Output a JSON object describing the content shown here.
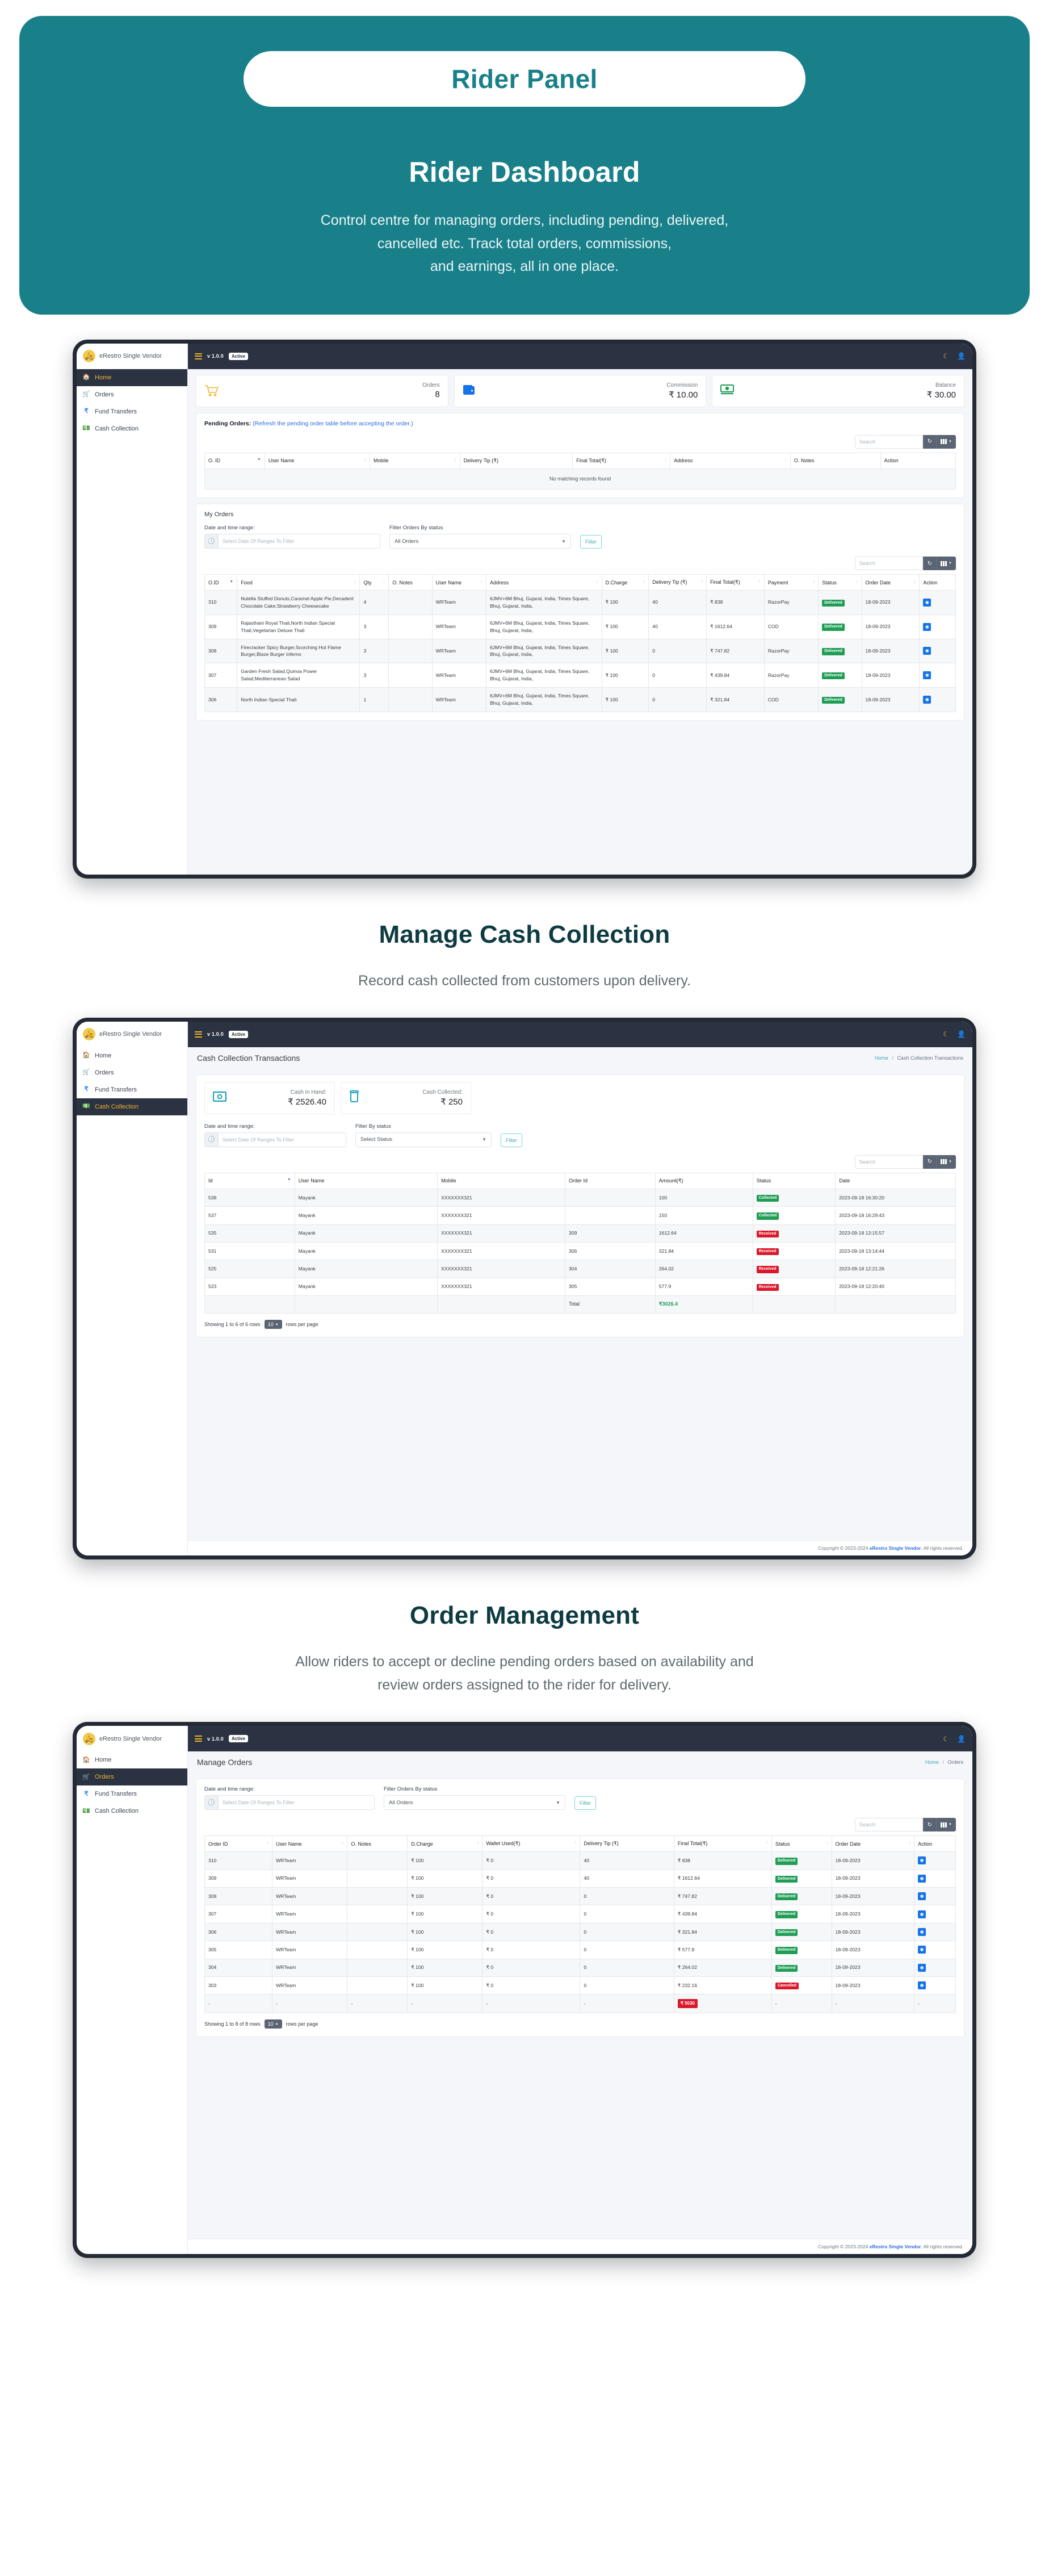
{
  "hero": {
    "pill_label": "Rider Panel",
    "title": "Rider Dashboard",
    "subtitle_line1": "Control centre for managing orders, including pending, delivered,",
    "subtitle_line2": "cancelled etc. Track total orders, commissions,",
    "subtitle_line3": "and earnings, all in one place.",
    "accent_color": "#19808a"
  },
  "sections": [
    {
      "title": "Manage Cash Collection",
      "subtitle_line1": "Record cash collected from customers upon delivery.",
      "subtitle_line2": ""
    },
    {
      "title": "Order Management",
      "subtitle_line1": "Allow riders to accept or decline pending orders based on availability and",
      "subtitle_line2": "review orders assigned to the rider for delivery."
    }
  ],
  "app": {
    "brand_name": "eRestro Single Vendor",
    "brand_logo_glyph": "🛵",
    "version": "v 1.0.0",
    "status_badge": "Active",
    "sidebar_items": [
      {
        "label": "Home",
        "icon": "home-icon"
      },
      {
        "label": "Orders",
        "icon": "cart-icon"
      },
      {
        "label": "Fund Transfers",
        "icon": "rupee-icon"
      },
      {
        "label": "Cash Collection",
        "icon": "cash-icon"
      }
    ],
    "topbar_icons": [
      "moon-icon",
      "user-icon"
    ],
    "footer": {
      "prefix": "Copyright © 2023-2024 ",
      "brand": "eRestro Single Vendor",
      "suffix": ". All rights reserved."
    }
  },
  "dashboard": {
    "active_nav": "Home",
    "stats": [
      {
        "label": "Orders",
        "value": "8",
        "icon": "cart-icon"
      },
      {
        "label": "Commission",
        "value": "₹ 10.00",
        "icon": "wallet-icon"
      },
      {
        "label": "Balance",
        "value": "₹ 30.00",
        "icon": "money-icon"
      }
    ],
    "pending": {
      "heading": "Pending Orders:",
      "note": "(Refresh the pending order table before accepting the order.)",
      "search_placeholder": "Search",
      "columns": [
        "O. ID",
        "User Name",
        "Mobile",
        "Delivery Tip (₹)",
        "Final Total(₹)",
        "Address",
        "O. Notes",
        "Action"
      ],
      "empty_message": "No matching records found"
    },
    "my_orders": {
      "title": "My Orders",
      "date_label": "Date and time range:",
      "date_placeholder": "Select Date Of Ranges To Filter",
      "status_label": "Filter Orders By status",
      "status_value": "All Orders",
      "filter_button": "Filter",
      "search_placeholder": "Search",
      "columns": [
        "O.ID",
        "Food",
        "Qty",
        "O. Notes",
        "User Name",
        "Address",
        "D.Charge",
        "Delivery Tip (₹)",
        "Final Total(₹)",
        "Payment",
        "Status",
        "Order Date",
        "Action"
      ],
      "rows": [
        {
          "oid": "310",
          "food": "Nutella Stuffed Donuts,Caramel Apple Pie,Decadent Chocolate Cake,Strawberry Cheesecake",
          "qty": "4",
          "notes": "",
          "user": "WRTeam",
          "address": "6JMV+6M Bhuj, Gujarat, India, Times Square, Bhuj, Gujarat, India,",
          "dcharge": "₹ 100",
          "tip": "40",
          "final": "₹ 838",
          "payment": "RazorPay",
          "status": "Delivered",
          "status_kind": "green",
          "date": "18-09-2023"
        },
        {
          "oid": "309",
          "food": "Rajasthani Royal Thali,North Indian Special Thali,Vegetarian Deluxe Thali",
          "qty": "3",
          "notes": "",
          "user": "WRTeam",
          "address": "6JMV+6M Bhuj, Gujarat, India, Times Square, Bhuj, Gujarat, India,",
          "dcharge": "₹ 100",
          "tip": "40",
          "final": "₹ 1612.64",
          "payment": "COD",
          "status": "Delivered",
          "status_kind": "green",
          "date": "18-09-2023"
        },
        {
          "oid": "308",
          "food": "Firecracker Spicy Burger,Scorching Hot Flame Burger,Blaze Burger Inferno",
          "qty": "3",
          "notes": "",
          "user": "WRTeam",
          "address": "6JMV+6M Bhuj, Gujarat, India, Times Square, Bhuj, Gujarat, India,",
          "dcharge": "₹ 100",
          "tip": "0",
          "final": "₹ 747.82",
          "payment": "RazorPay",
          "status": "Delivered",
          "status_kind": "green",
          "date": "18-09-2023"
        },
        {
          "oid": "307",
          "food": "Garden Fresh Salad,Quinoa Power Salad,Mediterranean Salad",
          "qty": "3",
          "notes": "",
          "user": "WRTeam",
          "address": "6JMV+6M Bhuj, Gujarat, India, Times Square, Bhuj, Gujarat, India,",
          "dcharge": "₹ 100",
          "tip": "0",
          "final": "₹ 439.84",
          "payment": "RazorPay",
          "status": "Delivered",
          "status_kind": "green",
          "date": "18-09-2023"
        },
        {
          "oid": "306",
          "food": "North Indian Special Thali",
          "qty": "1",
          "notes": "",
          "user": "WRTeam",
          "address": "6JMV+6M Bhuj, Gujarat, India, Times Square, Bhuj, Gujarat, India,",
          "dcharge": "₹ 100",
          "tip": "0",
          "final": "₹ 321.84",
          "payment": "COD",
          "status": "Delivered",
          "status_kind": "green",
          "date": "18-09-2023"
        }
      ]
    }
  },
  "cash_collection": {
    "active_nav": "Cash Collection",
    "page_title": "Cash Collection Transactions",
    "crumb_home": "Home",
    "crumb_current": "Cash Collection Transactions",
    "stats": [
      {
        "label": "Cash in Hand:",
        "value": "₹ 2526.40",
        "icon": "cash-note-icon"
      },
      {
        "label": "Cash Collected:",
        "value": "₹ 250",
        "icon": "cash-can-icon"
      }
    ],
    "date_label": "Date and time range:",
    "date_placeholder": "Select Date Of Ranges To Filter",
    "status_label": "Filter By status",
    "status_value": "Select Status",
    "filter_button": "Filter",
    "search_placeholder": "Search",
    "columns": [
      "Id",
      "User Name",
      "Mobile",
      "Order Id",
      "Amount(₹)",
      "Status",
      "Date"
    ],
    "rows": [
      {
        "id": "538",
        "user": "Mayank",
        "mobile": "XXXXXXX321",
        "order_id": "",
        "amount": "100",
        "status": "Collected",
        "status_kind": "green",
        "date": "2023-09-18 16:30:20"
      },
      {
        "id": "537",
        "user": "Mayank",
        "mobile": "XXXXXXX321",
        "order_id": "",
        "amount": "150",
        "status": "Collected",
        "status_kind": "green",
        "date": "2023-09-18 16:29:43"
      },
      {
        "id": "535",
        "user": "Mayank",
        "mobile": "XXXXXXX321",
        "order_id": "309",
        "amount": "1612.64",
        "status": "Received",
        "status_kind": "red",
        "date": "2023-09-18 13:15:57"
      },
      {
        "id": "531",
        "user": "Mayank",
        "mobile": "XXXXXXX321",
        "order_id": "306",
        "amount": "321.84",
        "status": "Received",
        "status_kind": "red",
        "date": "2023-09-18 13:14:44"
      },
      {
        "id": "525",
        "user": "Mayank",
        "mobile": "XXXXXXX321",
        "order_id": "304",
        "amount": "264.02",
        "status": "Received",
        "status_kind": "red",
        "date": "2023-09-18 12:21:26"
      },
      {
        "id": "523",
        "user": "Mayank",
        "mobile": "XXXXXXX321",
        "order_id": "305",
        "amount": "577.9",
        "status": "Received",
        "status_kind": "red",
        "date": "2023-09-18 12:20:40"
      }
    ],
    "total_label": "Total",
    "total_value": "₹3026.4",
    "showing_text": "Showing 1 to 6 of 6 rows",
    "rows_per_page": "10",
    "rows_per_page_suffix": "rows per page"
  },
  "manage_orders": {
    "active_nav": "Orders",
    "page_title": "Manage Orders",
    "crumb_home": "Home",
    "crumb_current": "Orders",
    "date_label": "Date and time range:",
    "date_placeholder": "Select Date Of Ranges To Filter",
    "status_label": "Filter Orders By status",
    "status_value": "All Orders",
    "filter_button": "Filter",
    "search_placeholder": "Search",
    "columns": [
      "Order ID",
      "User Name",
      "O. Notes",
      "D.Charge",
      "Wallet Used(₹)",
      "Delivery Tip (₹)",
      "Final Total(₹)",
      "Status",
      "Order Date",
      "Action"
    ],
    "rows": [
      {
        "order_id": "310",
        "user": "WRTeam",
        "notes": "",
        "dcharge": "₹ 100",
        "wallet": "₹ 0",
        "tip": "40",
        "final": "₹ 838",
        "status": "Delivered",
        "status_kind": "green",
        "date": "18-09-2023"
      },
      {
        "order_id": "309",
        "user": "WRTeam",
        "notes": "",
        "dcharge": "₹ 100",
        "wallet": "₹ 0",
        "tip": "40",
        "final": "₹ 1612.64",
        "status": "Delivered",
        "status_kind": "green",
        "date": "18-09-2023"
      },
      {
        "order_id": "308",
        "user": "WRTeam",
        "notes": "",
        "dcharge": "₹ 100",
        "wallet": "₹ 0",
        "tip": "0",
        "final": "₹ 747.82",
        "status": "Delivered",
        "status_kind": "green",
        "date": "18-09-2023"
      },
      {
        "order_id": "307",
        "user": "WRTeam",
        "notes": "",
        "dcharge": "₹ 100",
        "wallet": "₹ 0",
        "tip": "0",
        "final": "₹ 439.84",
        "status": "Delivered",
        "status_kind": "green",
        "date": "18-09-2023"
      },
      {
        "order_id": "306",
        "user": "WRTeam",
        "notes": "",
        "dcharge": "₹ 100",
        "wallet": "₹ 0",
        "tip": "0",
        "final": "₹ 321.84",
        "status": "Delivered",
        "status_kind": "green",
        "date": "18-09-2023"
      },
      {
        "order_id": "305",
        "user": "WRTeam",
        "notes": "",
        "dcharge": "₹ 100",
        "wallet": "₹ 0",
        "tip": "0",
        "final": "₹ 577.9",
        "status": "Delivered",
        "status_kind": "green",
        "date": "18-09-2023"
      },
      {
        "order_id": "304",
        "user": "WRTeam",
        "notes": "",
        "dcharge": "₹ 100",
        "wallet": "₹ 0",
        "tip": "0",
        "final": "₹ 264.02",
        "status": "Delivered",
        "status_kind": "green",
        "date": "18-09-2023"
      },
      {
        "order_id": "303",
        "user": "WRTeam",
        "notes": "",
        "dcharge": "₹ 100",
        "wallet": "₹ 0",
        "tip": "0",
        "final": "₹ 232.16",
        "status": "Cancelled",
        "status_kind": "red",
        "date": "18-09-2023"
      }
    ],
    "total_row_dash": "-",
    "total_badge": "₹ 5030",
    "showing_text": "Showing 1 to 8 of 8 rows",
    "rows_per_page": "10",
    "rows_per_page_suffix": "rows per page"
  }
}
